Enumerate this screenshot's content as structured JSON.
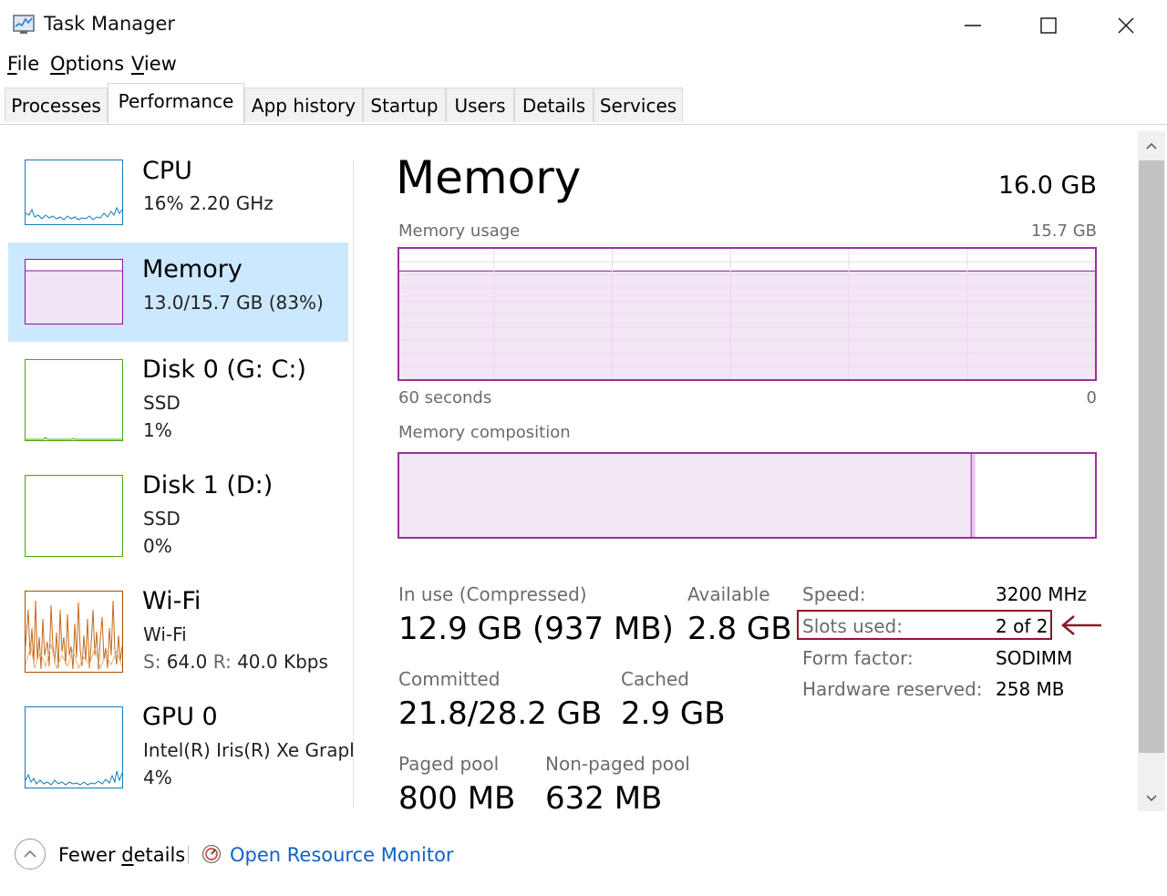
{
  "window": {
    "title": "Task Manager",
    "icon": "task-manager-icon"
  },
  "menu": [
    {
      "label": "File",
      "key": "F",
      "rest": "ile"
    },
    {
      "label": "Options",
      "key": "O",
      "rest": "ptions"
    },
    {
      "label": "View",
      "key": "V",
      "rest": "iew"
    }
  ],
  "tabs": [
    "Processes",
    "Performance",
    "App history",
    "Startup",
    "Users",
    "Details",
    "Services"
  ],
  "active_tab": "Performance",
  "sidebar": {
    "items": [
      {
        "title": "CPU",
        "line1": "16%  2.20 GHz",
        "line2": "",
        "color": "#117dbb"
      },
      {
        "title": "Memory",
        "line1": "13.0/15.7 GB (83%)",
        "line2": "",
        "color": "#8b12ae"
      },
      {
        "title": "Disk 0 (G: C:)",
        "line1": "SSD",
        "line2": "1%",
        "color": "#4da60c"
      },
      {
        "title": "Disk 1 (D:)",
        "line1": "SSD",
        "line2": "0%",
        "color": "#4da60c"
      },
      {
        "title": "Wi-Fi",
        "line1": "Wi-Fi",
        "line2_s_label": "S:",
        "line2_s_value": "64.0",
        "line2_r_label": "R:",
        "line2_r_value": "40.0 Kbps",
        "color": "#a74f01"
      },
      {
        "title": "GPU 0",
        "line1": "Intel(R) Iris(R) Xe Graphics",
        "line2": "4%",
        "color": "#117dbb"
      }
    ]
  },
  "memory": {
    "title": "Memory",
    "total": "16.0 GB",
    "usage_label": "Memory usage",
    "usage_max": "15.7 GB",
    "x_left": "60 seconds",
    "x_right": "0",
    "usage_fraction": 0.83,
    "composition_label": "Memory composition",
    "composition": {
      "in_use_fraction": 0.822,
      "modified_fraction": 0.006
    },
    "stats": {
      "in_use_label": "In use (Compressed)",
      "in_use_value": "12.9 GB (937 MB)",
      "available_label": "Available",
      "available_value": "2.8 GB",
      "committed_label": "Committed",
      "committed_value": "21.8/28.2 GB",
      "cached_label": "Cached",
      "cached_value": "2.9 GB",
      "paged_label": "Paged pool",
      "paged_value": "800 MB",
      "nonpaged_label": "Non-paged pool",
      "nonpaged_value": "632 MB"
    },
    "props": [
      {
        "label": "Speed:",
        "value": "3200 MHz"
      },
      {
        "label": "Slots used:",
        "value": "2 of 2"
      },
      {
        "label": "Form factor:",
        "value": "SODIMM"
      },
      {
        "label": "Hardware reserved:",
        "value": "258 MB"
      }
    ]
  },
  "annotation": {
    "color": "#8b1a2b"
  },
  "footer": {
    "fewer_pre": "Fewer ",
    "fewer_key": "d",
    "fewer_post": "etails",
    "resmon_label": "Open Resource Monitor"
  },
  "colors": {
    "selected_bg": "#cce8ff",
    "memory_accent": "#9a2f9f",
    "link": "#0f62c7"
  }
}
